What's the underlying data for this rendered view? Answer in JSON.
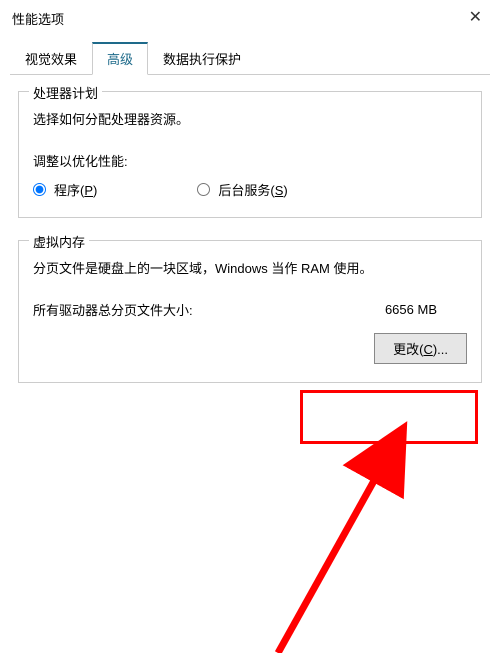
{
  "window": {
    "title": "性能选项"
  },
  "tabs": {
    "visual": "视觉效果",
    "advanced": "高级",
    "dep": "数据执行保护"
  },
  "processor": {
    "group_title": "处理器计划",
    "desc": "选择如何分配处理器资源。",
    "adjust_label": "调整以优化性能:",
    "radio_programs_pre": "程序(",
    "radio_programs_key": "P",
    "radio_programs_post": ")",
    "radio_bg_pre": "后台服务(",
    "radio_bg_key": "S",
    "radio_bg_post": ")"
  },
  "vm": {
    "group_title": "虚拟内存",
    "desc": "分页文件是硬盘上的一块区域，Windows 当作 RAM 使用。",
    "total_label": "所有驱动器总分页文件大小:",
    "total_value": "6656 MB",
    "change_pre": "更改(",
    "change_key": "C",
    "change_post": ")..."
  },
  "annotation": {
    "highlight_color": "#ff0000"
  }
}
